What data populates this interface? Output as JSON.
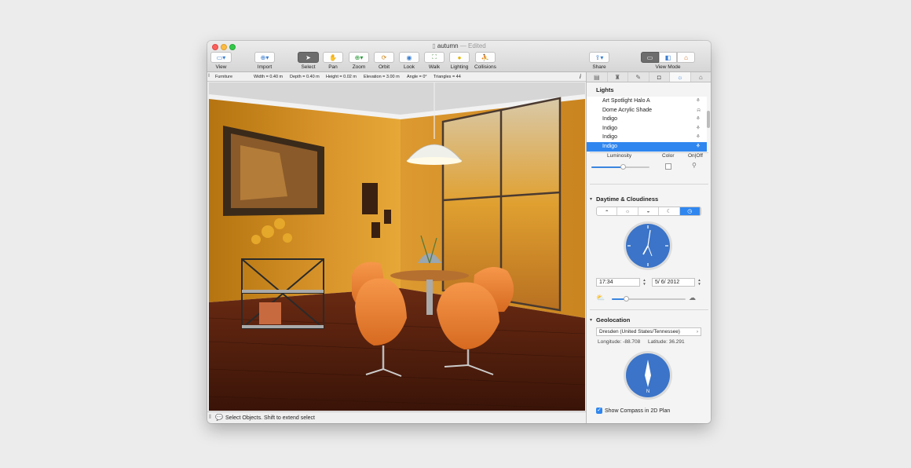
{
  "window": {
    "title": "autumn",
    "edited": "— Edited"
  },
  "toolbar": {
    "view": "View",
    "import": "Import",
    "select": "Select",
    "pan": "Pan",
    "zoom": "Zoom",
    "orbit": "Orbit",
    "look": "Look",
    "walk": "Walk",
    "lighting": "Lighting",
    "collisions": "Collisions",
    "share": "Share",
    "view_mode": "View Mode"
  },
  "infobar": {
    "section": "Furniture",
    "width": "Width = 0.40 m",
    "depth": "Depth = 0.40 m",
    "height": "Height = 0.02 m",
    "elevation": "Elevation = 3.00 m",
    "angle": "Angle = 0°",
    "triangles": "Triangles = 44",
    "info_glyph": "i"
  },
  "status": {
    "message": "Select Objects. Shift to extend select"
  },
  "sidebar": {
    "lights": {
      "title": "Lights",
      "items": [
        {
          "label": "Art Spotlight Halo A",
          "selected": false
        },
        {
          "label": "Dome Acrylic Shade",
          "selected": false
        },
        {
          "label": "Indigo",
          "selected": false
        },
        {
          "label": "Indigo",
          "selected": false
        },
        {
          "label": "Indigo",
          "selected": false
        },
        {
          "label": "Indigo",
          "selected": true
        }
      ],
      "col_luminosity": "Luminosity",
      "col_color": "Color",
      "col_onoff": "On|Off",
      "luminosity": 0.55
    },
    "daytime": {
      "title": "Daytime & Cloudiness",
      "time": "17:34",
      "date": "5/  6/ 2012",
      "cloudiness": 0.2
    },
    "geolocation": {
      "title": "Geolocation",
      "location": "Dresden (United States/Tennessee)",
      "longitude": "Longitude: -88.708",
      "latitude": "Latitude: 36.291",
      "compass_n": "N",
      "show_compass": "Show Compass in 2D Plan",
      "show_compass_checked": true
    }
  },
  "colors": {
    "accent": "#2f86ef",
    "clock": "#3b74c8"
  }
}
